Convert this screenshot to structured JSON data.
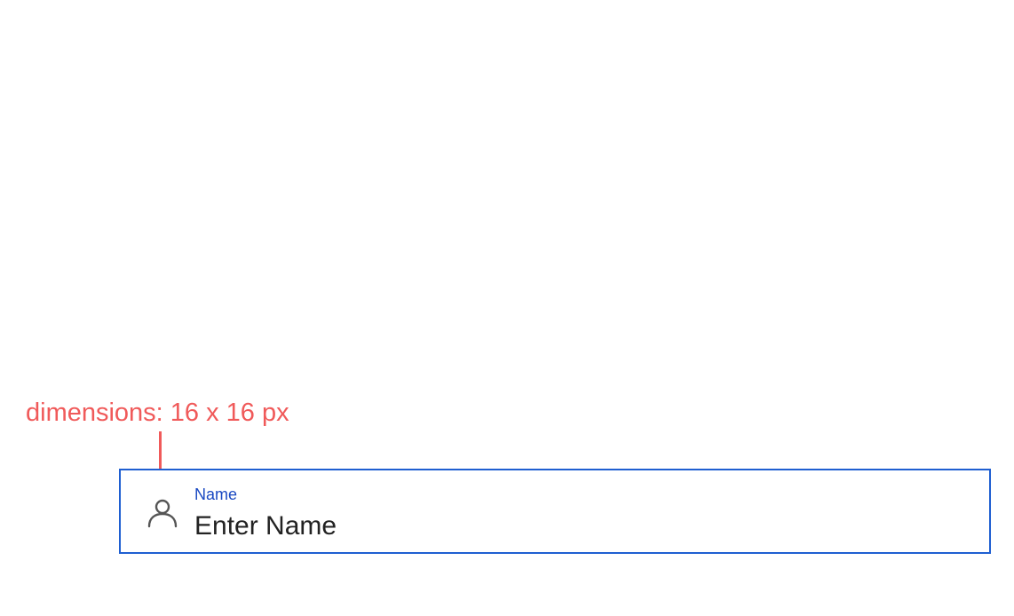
{
  "annotation": {
    "text": "dimensions: 16 x 16 px",
    "color": "#f05a5a"
  },
  "field": {
    "label": "Name",
    "value": "Enter Name",
    "icon": "person-icon",
    "border_color": "#1f5fd1",
    "label_color": "#1a49c2",
    "text_color": "#222222",
    "icon_color": "#555555"
  }
}
